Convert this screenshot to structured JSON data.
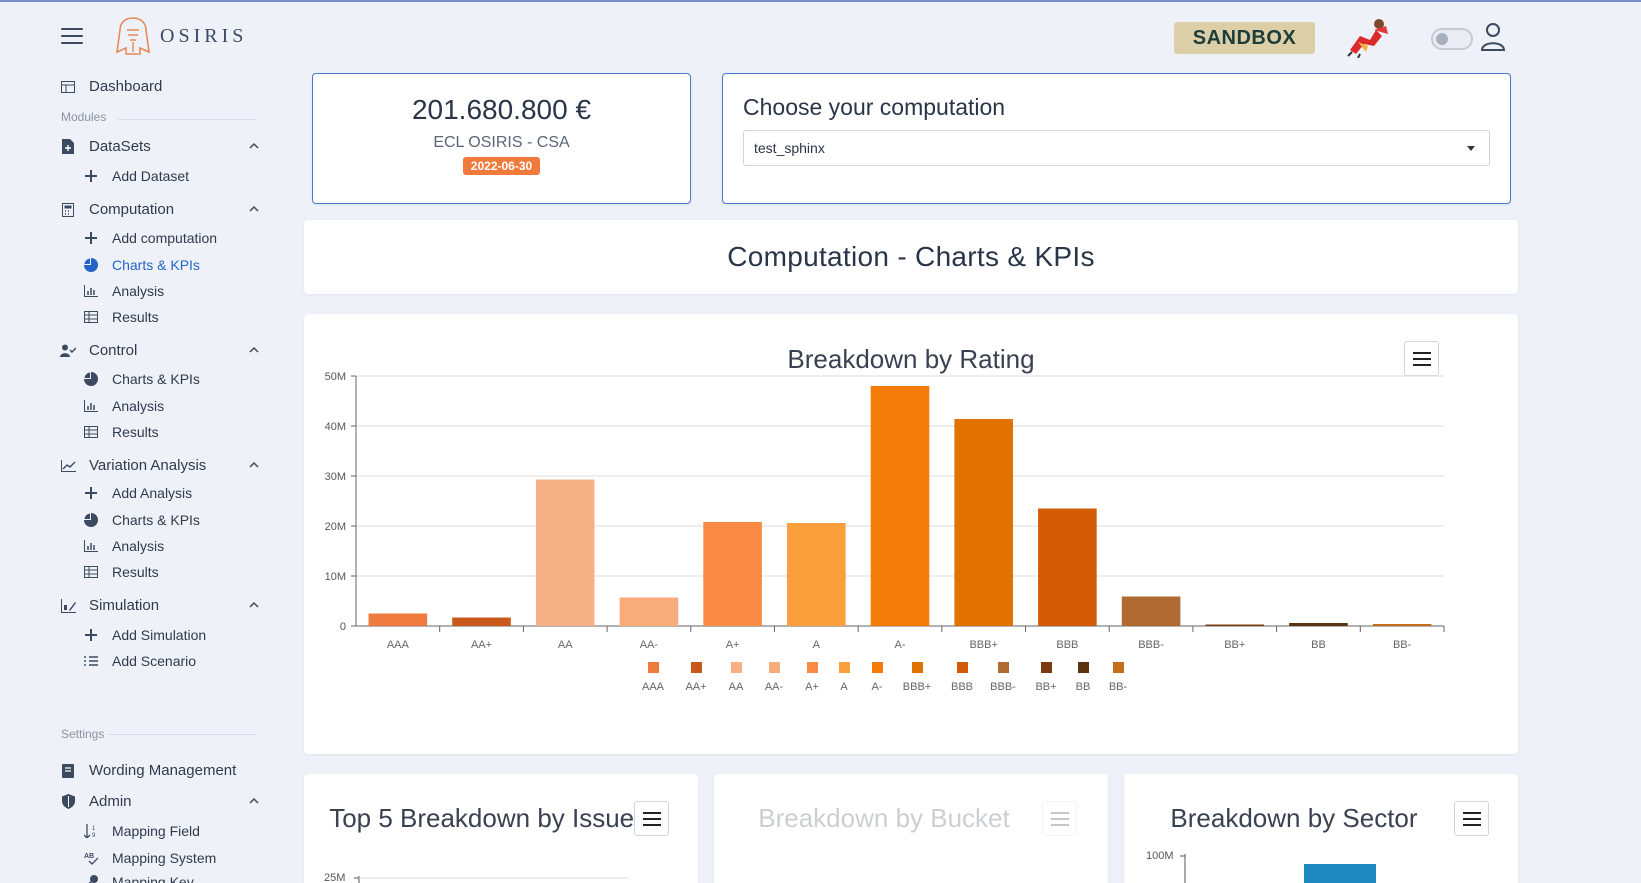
{
  "app": {
    "name": "OSIRIS",
    "env_badge": "SANDBOX"
  },
  "sidebar": {
    "dashboard": "Dashboard",
    "modules_label": "Modules",
    "datasets": {
      "label": "DataSets",
      "items": [
        "Add Dataset"
      ]
    },
    "computation": {
      "label": "Computation",
      "items": [
        "Add computation",
        "Charts & KPIs",
        "Analysis",
        "Results"
      ]
    },
    "control": {
      "label": "Control",
      "items": [
        "Charts & KPIs",
        "Analysis",
        "Results"
      ]
    },
    "variation": {
      "label": "Variation Analysis",
      "items": [
        "Add Analysis",
        "Charts & KPIs",
        "Analysis",
        "Results"
      ]
    },
    "simulation": {
      "label": "Simulation",
      "items": [
        "Add Simulation",
        "Add Scenario"
      ]
    },
    "settings_label": "Settings",
    "wording": "Wording Management",
    "admin": {
      "label": "Admin",
      "items": [
        "Mapping Field",
        "Mapping System",
        "Mapping Key"
      ]
    }
  },
  "kpi": {
    "value": "201.680.800 €",
    "label": "ECL OSIRIS - CSA",
    "date": "2022-06-30"
  },
  "computation_select": {
    "title": "Choose your computation",
    "value": "test_sphinx"
  },
  "page_title": "Computation - Charts & KPIs",
  "chart_data": [
    {
      "type": "bar",
      "title": "Breakdown by Rating",
      "categories": [
        "AAA",
        "AA+",
        "AA",
        "AA-",
        "A+",
        "A",
        "A-",
        "BBB+",
        "BBB",
        "BBB-",
        "BB+",
        "BB",
        "BB-"
      ],
      "values": [
        2500000,
        1700000,
        29300000,
        5700000,
        20800000,
        20600000,
        48000000,
        41400000,
        23500000,
        5900000,
        300000,
        600000,
        400000
      ],
      "colors": [
        "#ee7a3d",
        "#c9581b",
        "#f5b185",
        "#f8ac7c",
        "#f88a45",
        "#fb9f3c",
        "#f57b08",
        "#e27200",
        "#d35a05",
        "#b06a32",
        "#7a3b12",
        "#5b3310",
        "#c4701a"
      ],
      "ylim": [
        0,
        50000000
      ],
      "yticks": [
        "0",
        "10M",
        "20M",
        "30M",
        "40M",
        "50M"
      ],
      "legend": "bottom",
      "grid": true
    },
    {
      "type": "bar",
      "title": "Top 5 Breakdown by Issuer",
      "yticks": [
        "25M"
      ]
    },
    {
      "type": "bar",
      "title": "Breakdown by Bucket"
    },
    {
      "type": "bar",
      "title": "Breakdown by Sector",
      "yticks": [
        "100M"
      ]
    }
  ]
}
